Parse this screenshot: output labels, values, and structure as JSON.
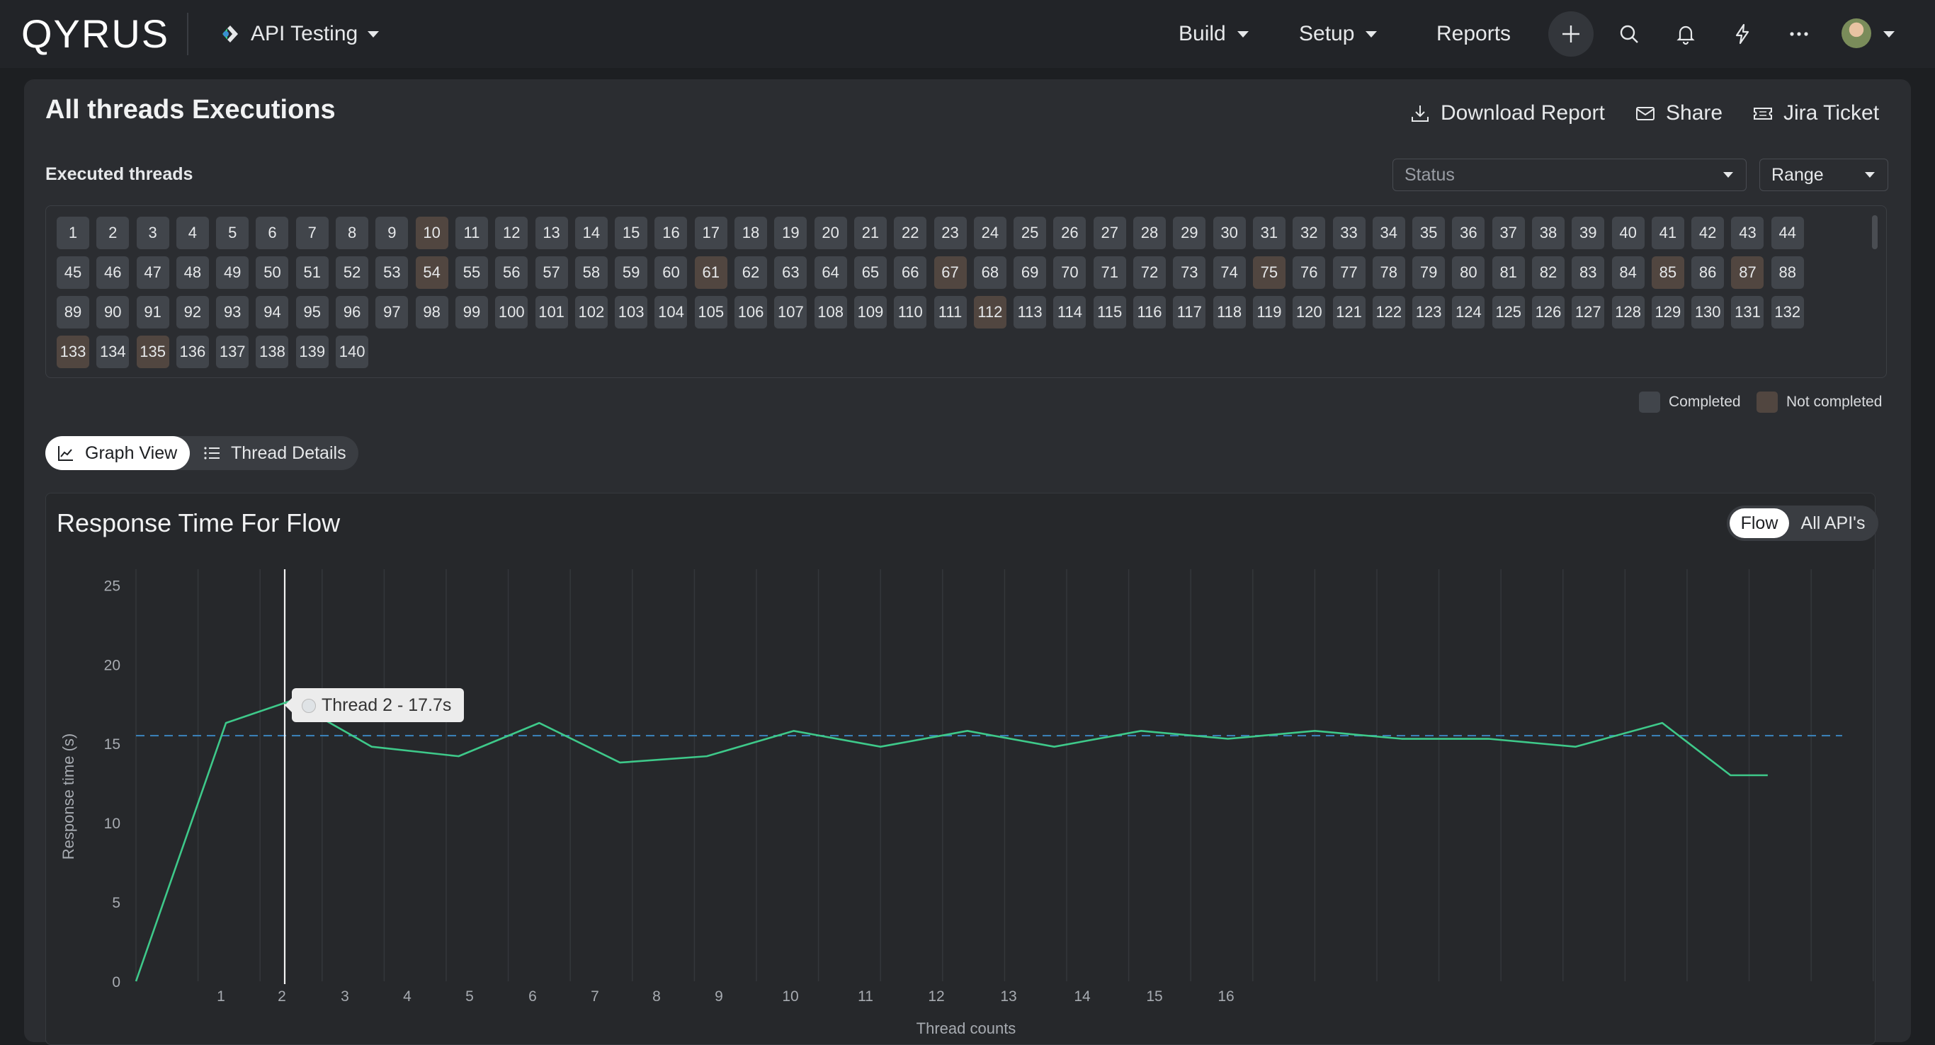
{
  "app": {
    "logo_text": "QYRUS",
    "project": "API Testing",
    "nav": [
      "Build",
      "Setup",
      "Reports"
    ]
  },
  "page": {
    "title": "All threads Executions",
    "actions": {
      "download": "Download Report",
      "share": "Share",
      "jira": "Jira Ticket"
    },
    "executed_label": "Executed threads",
    "status_placeholder": "Status",
    "range_label": "Range"
  },
  "threads": {
    "total": 140,
    "not_completed": [
      10,
      54,
      61,
      67,
      75,
      85,
      87,
      112,
      133,
      135
    ]
  },
  "legend": {
    "completed": "Completed",
    "not_completed": "Not completed"
  },
  "views": {
    "graph": "Graph View",
    "details": "Thread Details"
  },
  "chart_panel": {
    "title": "Response Time For Flow",
    "flow": "Flow",
    "all_apis": "All API's",
    "tooltip": "Thread 2 - 17.7s"
  },
  "colors": {
    "line": "#3ec98a",
    "average": "#3a7fb5",
    "completed": "#41454b",
    "not_completed": "#514640"
  },
  "chart_data": {
    "type": "line",
    "ylabel": "Response time (s)",
    "xlabel": "Thread counts",
    "ylim": [
      0,
      26
    ],
    "y_ticks": [
      0,
      5,
      10,
      15,
      20,
      25
    ],
    "x_ticks": [
      1,
      2,
      3,
      4,
      5,
      6,
      7,
      8,
      9,
      10,
      11,
      12,
      13,
      14,
      15,
      16
    ],
    "average": 15.5,
    "x": [
      0,
      1,
      2.5,
      3.8,
      5.2,
      6.5,
      7.8,
      9,
      10.2,
      11.5,
      12.8,
      14,
      15.2,
      16.5,
      17.8,
      19,
      20.2,
      21.5,
      22.8,
      24,
      25.2,
      26.5,
      27.8,
      28.9,
      29.8
    ],
    "values": [
      0,
      16.3,
      17.7,
      14.8,
      14.2,
      16.3,
      13.8,
      14.2,
      15.8,
      14.8,
      15.8,
      14.8,
      15.8,
      15.3,
      15.8,
      15.3,
      15.3,
      14.8,
      16.3,
      13.0,
      13.0
    ],
    "series_points": [
      [
        0,
        0
      ],
      [
        1.45,
        16.3
      ],
      [
        2.5,
        17.7
      ],
      [
        3.8,
        14.8
      ],
      [
        5.2,
        14.2
      ],
      [
        6.5,
        16.3
      ],
      [
        7.8,
        13.8
      ],
      [
        9.2,
        14.2
      ],
      [
        10.6,
        15.8
      ],
      [
        12.0,
        14.8
      ],
      [
        13.4,
        15.8
      ],
      [
        14.8,
        14.8
      ],
      [
        16.2,
        15.8
      ],
      [
        17.6,
        15.3
      ],
      [
        19.0,
        15.8
      ],
      [
        20.4,
        15.3
      ],
      [
        21.8,
        15.3
      ],
      [
        23.2,
        14.8
      ],
      [
        24.6,
        16.3
      ],
      [
        25.7,
        13.0
      ],
      [
        26.3,
        13.0
      ]
    ]
  }
}
